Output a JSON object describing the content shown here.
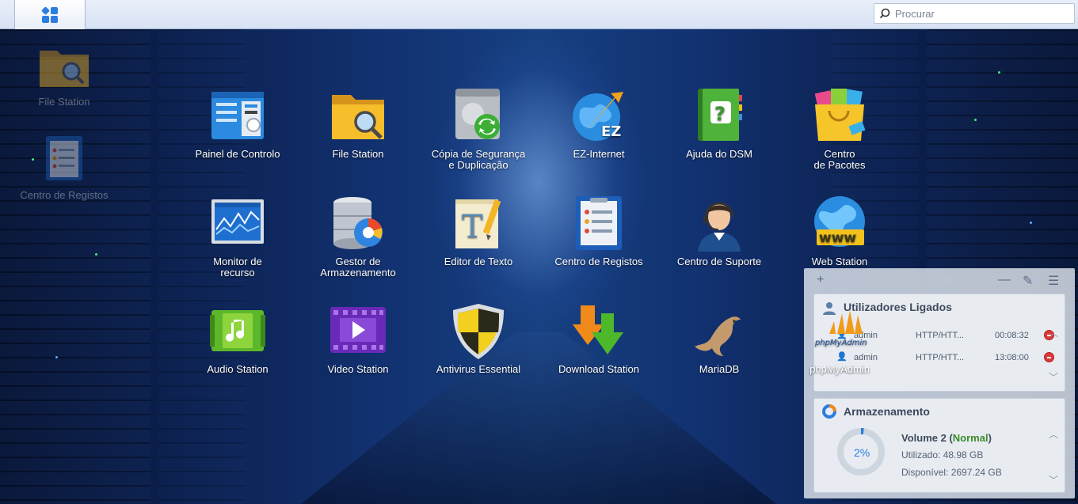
{
  "search": {
    "placeholder": "Procurar"
  },
  "desktop": {
    "shortcuts": [
      {
        "label": "File Station",
        "icon": "folder-search-icon"
      },
      {
        "label": "Centro de Registos",
        "icon": "log-center-icon"
      }
    ]
  },
  "apps": [
    {
      "label": "Painel de Controlo",
      "icon": "control-panel-icon"
    },
    {
      "label": "File Station",
      "icon": "folder-search-icon"
    },
    {
      "label": "Cópia de Segurança\ne Duplicação",
      "icon": "backup-icon"
    },
    {
      "label": "EZ-Internet",
      "icon": "ez-internet-icon"
    },
    {
      "label": "Ajuda do DSM",
      "icon": "help-book-icon"
    },
    {
      "label": "Centro\nde Pacotes",
      "icon": "package-bag-icon"
    },
    {
      "label": "Monitor de\nrecurso",
      "icon": "resource-monitor-icon"
    },
    {
      "label": "Gestor de\nArmazenamento",
      "icon": "storage-manager-icon"
    },
    {
      "label": "Editor de Texto",
      "icon": "text-editor-icon"
    },
    {
      "label": "Centro de Registos",
      "icon": "log-center-icon"
    },
    {
      "label": "Centro de Suporte",
      "icon": "support-agent-icon"
    },
    {
      "label": "Web Station",
      "icon": "web-globe-icon"
    },
    {
      "label": "Audio Station",
      "icon": "audio-note-icon"
    },
    {
      "label": "Video Station",
      "icon": "video-play-icon"
    },
    {
      "label": "Antivirus Essential",
      "icon": "antivirus-shield-icon"
    },
    {
      "label": "Download Station",
      "icon": "download-arrow-icon"
    },
    {
      "label": "MariaDB",
      "icon": "mariadb-seal-icon"
    },
    {
      "label": "phpMyAdmin",
      "icon": "phpmyadmin-sail-icon"
    }
  ],
  "phpmyadmin_logo_text": "phpMyAdmin",
  "widgets": {
    "users": {
      "title": "Utilizadores Ligados",
      "rows": [
        {
          "user": "admin",
          "protocol": "HTTP/HTT...",
          "time": "00:08:32"
        },
        {
          "user": "admin",
          "protocol": "HTTP/HTT...",
          "time": "13:08:00"
        }
      ]
    },
    "storage": {
      "title": "Armazenamento",
      "volume_name": "Volume 2 (",
      "status": "Normal",
      "status_close": ")",
      "usage_percent": "2%",
      "usage_fraction": 0.02,
      "used_label": "Utilizado: 48.98 GB",
      "available_label": "Disponível: 2697.24 GB"
    }
  },
  "colors": {
    "accent": "#2b7de0",
    "status_normal": "#3a8c2a",
    "stop": "#d83b3b"
  }
}
